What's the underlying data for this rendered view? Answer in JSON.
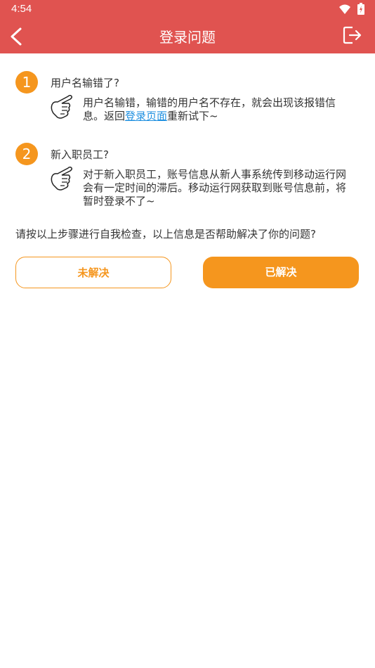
{
  "status_bar": {
    "time": "4:54"
  },
  "header": {
    "title": "登录问题"
  },
  "items": [
    {
      "number": "1",
      "question": "用户名输错了?",
      "answer_line1": "用户名输错，输错的用户名不存在，就会出现该报错信",
      "answer_prefix": "息。返回",
      "answer_link": "登录页面",
      "answer_suffix": "重新试下~"
    },
    {
      "number": "2",
      "question": "新入职员工?",
      "answer_line1": "对于新入职员工，账号信息从新人事系统传到移动运行网",
      "answer_line2": "会有一定时间的滞后。移动运行网获取到账号信息前，将",
      "answer_line3": "暂时登录不了~"
    }
  ],
  "check_text": "请按以上步骤进行自我检查，以上信息是否帮助解决了你的问题?",
  "buttons": {
    "unresolved": "未解决",
    "resolved": "已解决"
  },
  "colors": {
    "header": "#e05350",
    "accent": "#f5961e",
    "link": "#1d8fe0"
  }
}
